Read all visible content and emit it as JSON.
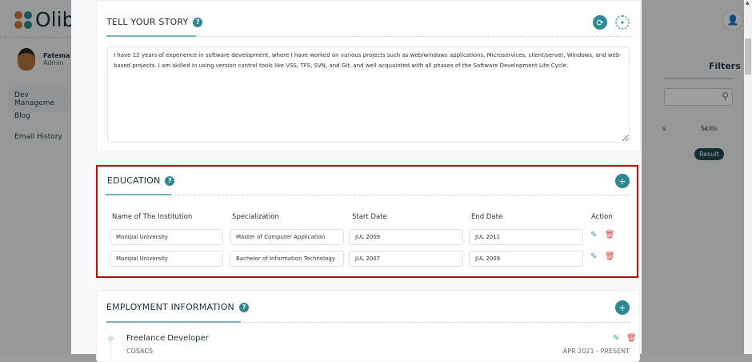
{
  "sidebar": {
    "brand": "Olibr",
    "user_name": "Fatema H",
    "user_role": "Admin",
    "items": [
      {
        "label": "Dev Manageme"
      },
      {
        "label": "Blog"
      },
      {
        "label": "Email History"
      }
    ]
  },
  "background": {
    "filters_label": "Filters",
    "col_partial": "s",
    "col_skills": "Skills",
    "result_label": "Result"
  },
  "story": {
    "title": "TELL YOUR STORY",
    "text": "I have 12 years of experience in software development, where I have worked on various projects such as web/windows applications, Microservices, client/server, Windows, and web-based projects. I am skilled in using version control tools like VSS, TFS, SVN, and Git, and well acquainted with all phases of the Software Development Life Cycle."
  },
  "education": {
    "title": "EDUCATION",
    "headers": [
      "Name of The Institution",
      "Specialization",
      "Start Date",
      "End Date",
      "Action"
    ],
    "rows": [
      {
        "institution": "Manipal University",
        "specialization": "Master of Computer Application",
        "start": "JUL 2009",
        "end": "JUL 2011"
      },
      {
        "institution": "Manipal University",
        "specialization": "Bachelor of Information Technology",
        "start": "JUL 2007",
        "end": "JUL 2009"
      }
    ]
  },
  "employment": {
    "title": "EMPLOYMENT INFORMATION",
    "items": [
      {
        "role": "Freelance Developer",
        "company": "COSACS",
        "period": "APR 2021 - PRESENT"
      }
    ]
  },
  "colors": {
    "accent": "#2b8a95",
    "delete": "#e84545",
    "highlight": "#e00000"
  }
}
